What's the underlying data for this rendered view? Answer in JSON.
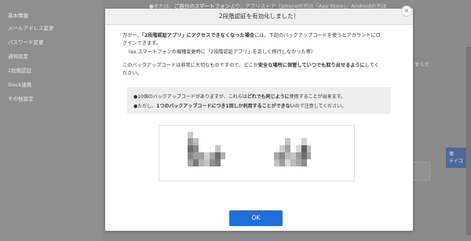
{
  "background": {
    "sidebar_items": [
      "基本情報",
      "メールアドレス変更",
      "パスワード変更",
      "通知設定",
      "2段階認証",
      "Slack連携",
      "その他設定"
    ],
    "top_text_prefix": "●または、",
    "top_text_bold": "ご自分のスマートフォン",
    "top_text_rest": "より、アプリストア（iphoneの方は「App Store」、Androidの方は",
    "side_text_1": "すくだ",
    "button_label": "保\nティコ"
  },
  "modal": {
    "title": "2段階認証を有効化しました！",
    "close_label": "×",
    "para1_line1_a": "万が一、",
    "para1_line1_b": "「2段階認証アプリ」にアクセスできなくなった場合",
    "para1_line1_c": "には、下記のバックアップコードを使うとアカウントにロ",
    "para1_line2": "グインできます。",
    "para1_line3": "（ex.スマートフォンの機種変更時に「2段階認証アプリ」を正しく移行しなかった等）",
    "para2_line1_a": "このバックアップコードは非常に大切なものですので、どこか",
    "para2_line1_b": "安全な場所に保管していつでも取り出せるように",
    "para2_line1_c": "してく",
    "para2_line2": "ださい。",
    "note_line1_a": "●10個のバックアップコードがありますが、これらは",
    "note_line1_b": "どれでも同じように",
    "note_line1_c": "使用することが出来ます。",
    "note_line2_a": "●ただし、",
    "note_line2_b": "1つのバックアップコードにつき1回しか利用することができない",
    "note_line2_c": "ので注意してください。",
    "ok_label": "OK"
  },
  "colors": {
    "overlay": "#8c8c8c",
    "primary_button": "#1e6fd9",
    "note_background": "#eeeeee"
  }
}
